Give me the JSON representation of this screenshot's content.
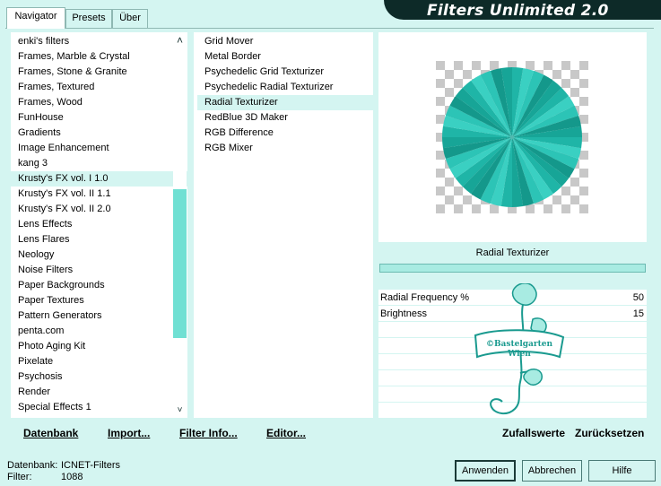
{
  "app": {
    "title": "Filters Unlimited 2.0"
  },
  "tabs": [
    {
      "label": "Navigator",
      "active": true
    },
    {
      "label": "Presets",
      "active": false
    },
    {
      "label": "Über",
      "active": false
    }
  ],
  "categories": [
    "enki's filters",
    "Frames, Marble & Crystal",
    "Frames, Stone & Granite",
    "Frames, Textured",
    "Frames, Wood",
    "FunHouse",
    "Gradients",
    "Image Enhancement",
    "kang 3",
    "Krusty's FX vol. I 1.0",
    "Krusty's FX vol. II 1.1",
    "Krusty's FX vol. II 2.0",
    "Lens Effects",
    "Lens Flares",
    "Neology",
    "Noise Filters",
    "Paper Backgrounds",
    "Paper Textures",
    "Pattern Generators",
    "penta.com",
    "Photo Aging Kit",
    "Pixelate",
    "Psychosis",
    "Render",
    "Special Effects 1"
  ],
  "selected_category": "Krusty's FX vol. I 1.0",
  "filters": [
    "Grid Mover",
    "Metal Border",
    "Psychedelic Grid Texturizer",
    "Psychedelic Radial Texturizer",
    "Radial Texturizer",
    "RedBlue 3D Maker",
    "RGB Difference",
    "RGB Mixer"
  ],
  "selected_filter": "Radial Texturizer",
  "preview": {
    "filter_name": "Radial Texturizer"
  },
  "parameters": [
    {
      "label": "Radial Frequency %",
      "value": "50"
    },
    {
      "label": "Brightness",
      "value": "15"
    }
  ],
  "watermark": {
    "line1": "©Bastelgarten",
    "line2": "Wien"
  },
  "toolbar": {
    "datenbank": "Datenbank",
    "import": "Import...",
    "filter_info": "Filter Info...",
    "editor": "Editor...",
    "zufallswerte": "Zufallswerte",
    "zuruecksetzen": "Zurücksetzen"
  },
  "status": {
    "datenbank_label": "Datenbank:",
    "datenbank_value": "ICNET-Filters",
    "filter_label": "Filter:",
    "filter_value": "1088"
  },
  "buttons": {
    "apply": "Anwenden",
    "cancel": "Abbrechen",
    "help": "Hilfe"
  },
  "colors": {
    "background": "#d4f5f1",
    "accent": "#70e0d3",
    "banner": "#0d2a28",
    "preview_teal": "#1fb5a7"
  }
}
